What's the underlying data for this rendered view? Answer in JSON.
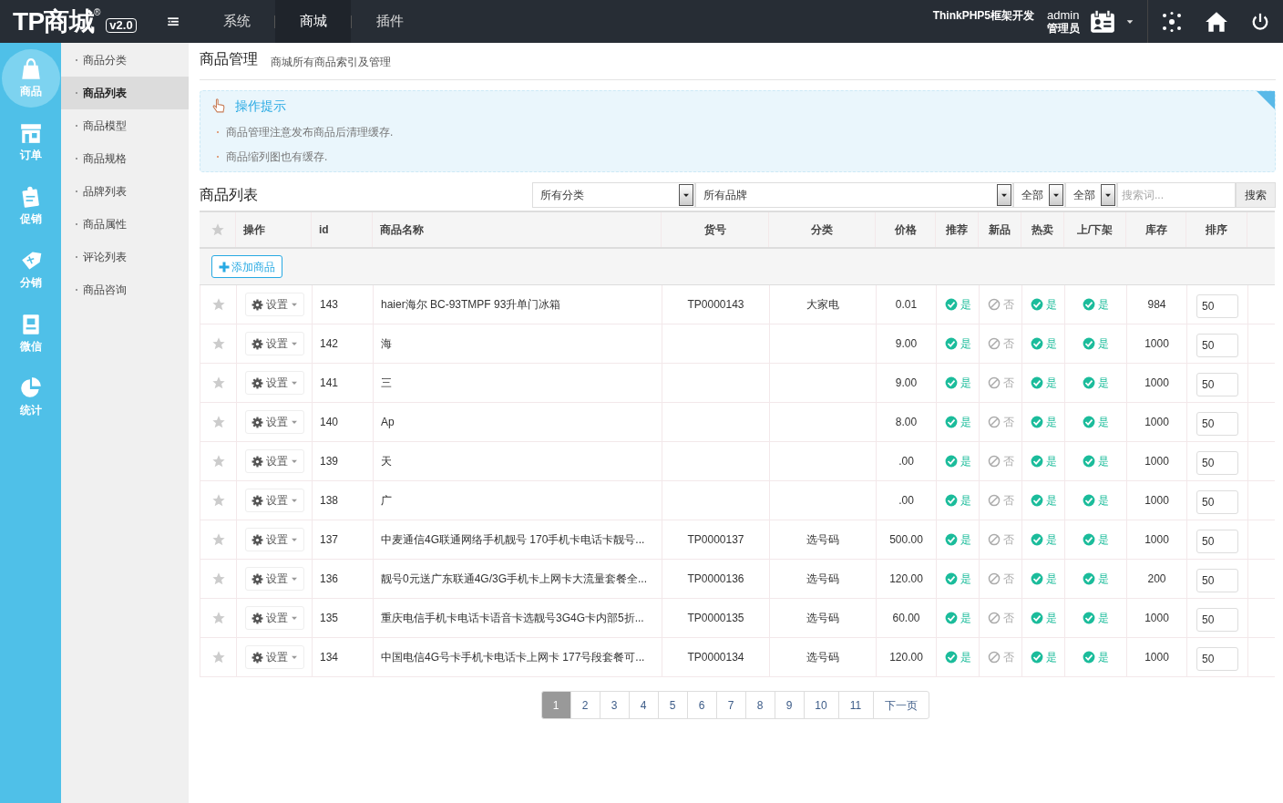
{
  "topbar": {
    "logo": "TP商城",
    "registered": "®",
    "version": "v2.0",
    "nav": [
      {
        "label": "系统",
        "selected": false
      },
      {
        "label": "商城",
        "selected": true
      },
      {
        "label": "插件",
        "selected": false
      }
    ],
    "framework": "ThinkPHP5框架开发",
    "user": {
      "name": "admin",
      "role": "管理员"
    }
  },
  "sidebar": {
    "items": [
      {
        "label": "商品",
        "selected": true
      },
      {
        "label": "订单",
        "selected": false
      },
      {
        "label": "促销",
        "selected": false
      },
      {
        "label": "分销",
        "selected": false
      },
      {
        "label": "微信",
        "selected": false
      },
      {
        "label": "统计",
        "selected": false
      }
    ]
  },
  "submenu": {
    "items": [
      {
        "label": "商品分类",
        "selected": false
      },
      {
        "label": "商品列表",
        "selected": true
      },
      {
        "label": "商品模型",
        "selected": false
      },
      {
        "label": "商品规格",
        "selected": false
      },
      {
        "label": "品牌列表",
        "selected": false
      },
      {
        "label": "商品属性",
        "selected": false
      },
      {
        "label": "评论列表",
        "selected": false
      },
      {
        "label": "商品咨询",
        "selected": false
      }
    ]
  },
  "page": {
    "title": "商品管理",
    "subtitle": "商城所有商品索引及管理"
  },
  "tips": {
    "title": "操作提示",
    "items": [
      "商品管理注意发布商品后清理缓存.",
      "商品缩列图也有缓存."
    ]
  },
  "list": {
    "title": "商品列表",
    "filters": [
      "所有分类",
      "所有品牌",
      "全部",
      "全部"
    ],
    "search": {
      "placeholder": "搜索词..."
    },
    "search_button": "搜索",
    "add_button": "添加商品"
  },
  "table": {
    "columns": [
      "操作",
      "id",
      "商品名称",
      "货号",
      "分类",
      "价格",
      "推荐",
      "新品",
      "热卖",
      "上/下架",
      "库存",
      "排序"
    ],
    "rows": [
      {
        "action": "设置",
        "id": "143",
        "name": "haier海尔 BC-93TMPF 93升单门冰箱",
        "sku": "TP0000143",
        "category": "大家电",
        "price": "0.01",
        "flags": [
          {
            "label": "是",
            "on": true
          },
          {
            "label": "否",
            "on": false
          },
          {
            "label": "是",
            "on": true
          },
          {
            "label": "是",
            "on": true
          }
        ],
        "stock": "984",
        "sort": "50"
      },
      {
        "action": "设置",
        "id": "142",
        "name": "海",
        "price": "9.00",
        "flags": [
          {
            "label": "是",
            "on": true
          },
          {
            "label": "否",
            "on": false
          },
          {
            "label": "是",
            "on": true
          },
          {
            "label": "是",
            "on": true
          }
        ],
        "stock": "1000",
        "sort": "50"
      },
      {
        "action": "设置",
        "id": "141",
        "name": "三",
        "price": "9.00",
        "flags": [
          {
            "label": "是",
            "on": true
          },
          {
            "label": "否",
            "on": false
          },
          {
            "label": "是",
            "on": true
          },
          {
            "label": "是",
            "on": true
          }
        ],
        "stock": "1000",
        "sort": "50"
      },
      {
        "action": "设置",
        "id": "140",
        "name": "Ap",
        "price": "8.00",
        "flags": [
          {
            "label": "是",
            "on": true
          },
          {
            "label": "否",
            "on": false
          },
          {
            "label": "是",
            "on": true
          },
          {
            "label": "是",
            "on": true
          }
        ],
        "stock": "1000",
        "sort": "50"
      },
      {
        "action": "设置",
        "id": "139",
        "name": "天",
        "price": ".00",
        "flags": [
          {
            "label": "是",
            "on": true
          },
          {
            "label": "否",
            "on": false
          },
          {
            "label": "是",
            "on": true
          },
          {
            "label": "是",
            "on": true
          }
        ],
        "stock": "1000",
        "sort": "50"
      },
      {
        "action": "设置",
        "id": "138",
        "name": "广",
        "price": ".00",
        "flags": [
          {
            "label": "是",
            "on": true
          },
          {
            "label": "否",
            "on": false
          },
          {
            "label": "是",
            "on": true
          },
          {
            "label": "是",
            "on": true
          }
        ],
        "stock": "1000",
        "sort": "50"
      },
      {
        "action": "设置",
        "id": "137",
        "name": "中麦通信4G联通网络手机靓号 170手机卡电话卡靓号...",
        "sku": "TP0000137",
        "category": "选号码",
        "price": "500.00",
        "flags": [
          {
            "label": "是",
            "on": true
          },
          {
            "label": "否",
            "on": false
          },
          {
            "label": "是",
            "on": true
          },
          {
            "label": "是",
            "on": true
          }
        ],
        "stock": "1000",
        "sort": "50"
      },
      {
        "action": "设置",
        "id": "136",
        "name": "靓号0元送广东联通4G/3G手机卡上网卡大流量套餐全...",
        "sku": "TP0000136",
        "category": "选号码",
        "price": "120.00",
        "flags": [
          {
            "label": "是",
            "on": true
          },
          {
            "label": "否",
            "on": false
          },
          {
            "label": "是",
            "on": true
          },
          {
            "label": "是",
            "on": true
          }
        ],
        "stock": "200",
        "sort": "50"
      },
      {
        "action": "设置",
        "id": "135",
        "name": "重庆电信手机卡电话卡语音卡选靓号3G4G卡内部5折...",
        "sku": "TP0000135",
        "category": "选号码",
        "price": "60.00",
        "flags": [
          {
            "label": "是",
            "on": true
          },
          {
            "label": "否",
            "on": false
          },
          {
            "label": "是",
            "on": true
          },
          {
            "label": "是",
            "on": true
          }
        ],
        "stock": "1000",
        "sort": "50"
      },
      {
        "action": "设置",
        "id": "134",
        "name": "中国电信4G号卡手机卡电话卡上网卡 177号段套餐可...",
        "sku": "TP0000134",
        "category": "选号码",
        "price": "120.00",
        "flags": [
          {
            "label": "是",
            "on": true
          },
          {
            "label": "否",
            "on": false
          },
          {
            "label": "是",
            "on": true
          },
          {
            "label": "是",
            "on": true
          }
        ],
        "stock": "1000",
        "sort": "50"
      }
    ]
  },
  "pagination": {
    "pages": [
      {
        "label": "1",
        "selected": true
      },
      {
        "label": "2",
        "selected": false
      },
      {
        "label": "3",
        "selected": false
      },
      {
        "label": "4",
        "selected": false
      },
      {
        "label": "5",
        "selected": false
      },
      {
        "label": "6",
        "selected": false
      },
      {
        "label": "7",
        "selected": false
      },
      {
        "label": "8",
        "selected": false
      },
      {
        "label": "9",
        "selected": false
      },
      {
        "label": "10",
        "selected": false
      },
      {
        "label": "11",
        "selected": false
      }
    ],
    "next": "下一页"
  }
}
